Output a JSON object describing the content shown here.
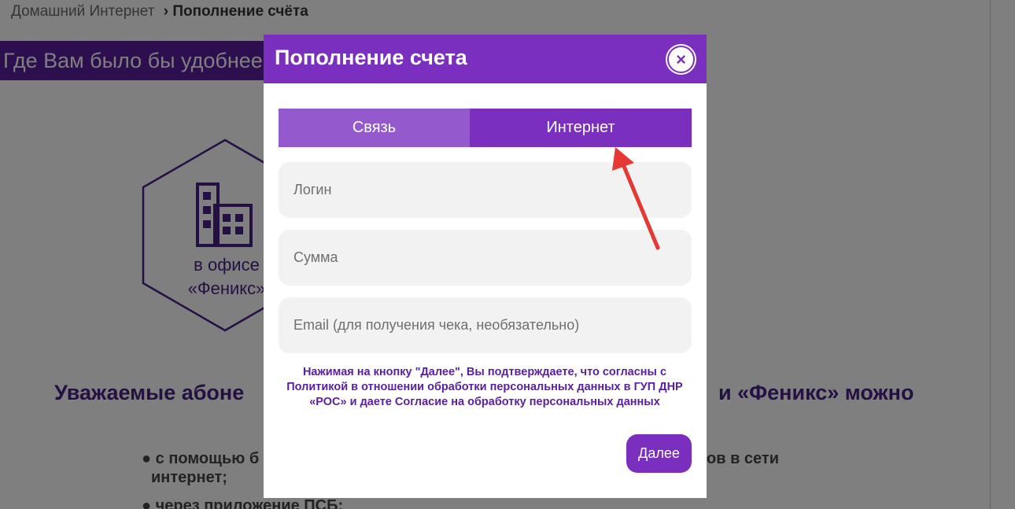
{
  "background": {
    "breadcrumb": {
      "parent": "Домашний Интернет",
      "separator": "›",
      "current": "Пополнение счёта"
    },
    "question_banner": "Где Вам было бы удобнее",
    "office_card": {
      "text": "в офисе\n«Феникс»"
    },
    "headline_left": "Уважаемые абоне",
    "headline_right": "и «Феникс» можно",
    "bullets": {
      "b1_left": "● с помощью б",
      "b1_cont": "интернет;",
      "b1_right": "ов в сети",
      "b2": "● через приложение ПСБ;"
    }
  },
  "modal": {
    "title": "Пополнение счета",
    "close_label": "×",
    "tabs": [
      {
        "label": "Связь",
        "active": false
      },
      {
        "label": "Интернет",
        "active": true
      }
    ],
    "fields": {
      "login_placeholder": "Логин",
      "sum_placeholder": "Сумма",
      "email_placeholder": "Email (для получения чека, необязательно)"
    },
    "consent_text": "Нажимая на кнопку \"Далее\", Вы подтверждаете, что согласны с Политикой в отношении обработки персональных данных в ГУП ДНР «РОС» и даете Согласие на обработку персональных данных",
    "next_label": "Далее"
  },
  "colors": {
    "brand_purple": "#7b2fbe",
    "tab_inactive": "#945acd",
    "arrow_red": "#e53935"
  }
}
